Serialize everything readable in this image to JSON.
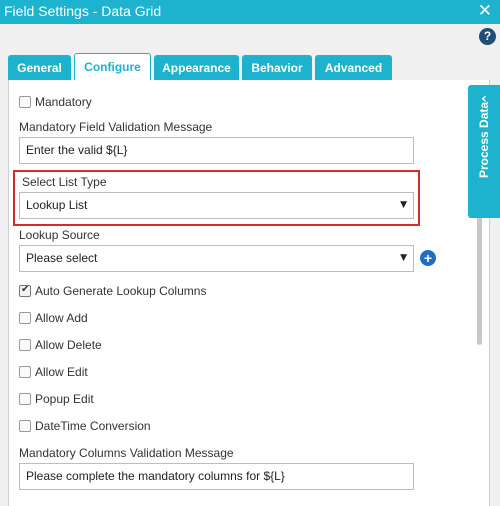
{
  "window": {
    "title": "Field Settings - Data Grid",
    "close_glyph": "✕"
  },
  "help": {
    "glyph": "?"
  },
  "tabs": [
    {
      "label": "General",
      "active": false
    },
    {
      "label": "Configure",
      "active": true
    },
    {
      "label": "Appearance",
      "active": false
    },
    {
      "label": "Behavior",
      "active": false
    },
    {
      "label": "Advanced",
      "active": false
    }
  ],
  "configure": {
    "mandatory": {
      "label": "Mandatory",
      "checked": false
    },
    "mandatory_message": {
      "label": "Mandatory Field Validation Message",
      "value": "Enter the valid ${L}"
    },
    "list_type": {
      "label": "Select List Type",
      "selected": "Lookup List"
    },
    "lookup_source": {
      "label": "Lookup Source",
      "selected": "Please select"
    },
    "auto_generate": {
      "label": "Auto Generate Lookup Columns",
      "checked": true
    },
    "allow_add": {
      "label": "Allow Add",
      "checked": false
    },
    "allow_delete": {
      "label": "Allow Delete",
      "checked": false
    },
    "allow_edit": {
      "label": "Allow Edit",
      "checked": false
    },
    "popup_edit": {
      "label": "Popup Edit",
      "checked": false
    },
    "datetime_conversion": {
      "label": "DateTime Conversion",
      "checked": false
    },
    "mandatory_columns_message": {
      "label": "Mandatory Columns Validation Message",
      "value": "Please complete the mandatory columns for ${L}"
    }
  },
  "side_panel": {
    "label": "Process Data",
    "chevron": "‹"
  },
  "glyphs": {
    "dropdown_arrow": "▼",
    "add": "+"
  },
  "colors": {
    "accent": "#1db3cf",
    "highlight_border": "#d12d2d",
    "add_button": "#1f6fbf",
    "help_icon": "#1f4e79"
  }
}
